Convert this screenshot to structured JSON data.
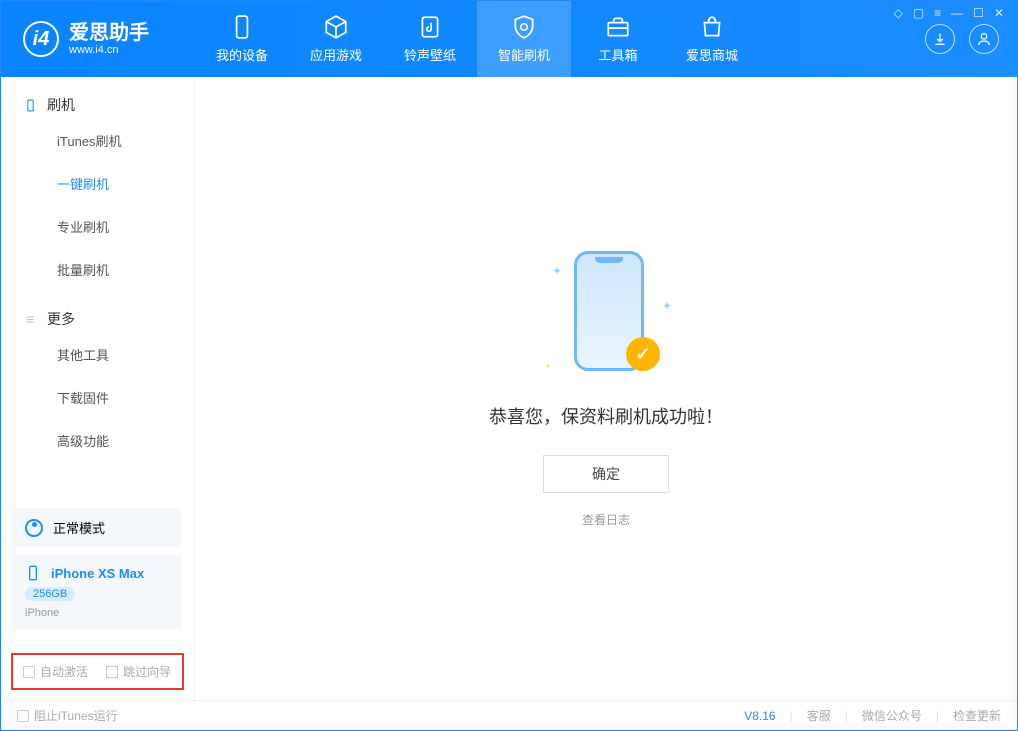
{
  "logo": {
    "title": "爱思助手",
    "url": "www.i4.cn"
  },
  "nav": {
    "device": "我的设备",
    "apps": "应用游戏",
    "ringtone": "铃声壁纸",
    "flash": "智能刷机",
    "toolbox": "工具箱",
    "store": "爱思商城"
  },
  "sidebar": {
    "section_flash": "刷机",
    "items_flash": {
      "itunes": "iTunes刷机",
      "onekey": "一键刷机",
      "pro": "专业刷机",
      "batch": "批量刷机"
    },
    "section_more": "更多",
    "items_more": {
      "other": "其他工具",
      "firmware": "下载固件",
      "advanced": "高级功能"
    }
  },
  "device_card": {
    "mode": "正常模式",
    "name": "iPhone XS Max",
    "storage": "256GB",
    "model": "iPhone"
  },
  "checkboxes": {
    "auto_activate": "自动激活",
    "skip_guide": "跳过向导"
  },
  "main": {
    "success": "恭喜您，保资料刷机成功啦！",
    "ok": "确定",
    "view_log": "查看日志"
  },
  "footer": {
    "block_itunes": "阻止iTunes运行",
    "version": "V8.16",
    "support": "客服",
    "wechat": "微信公众号",
    "update": "检查更新"
  }
}
